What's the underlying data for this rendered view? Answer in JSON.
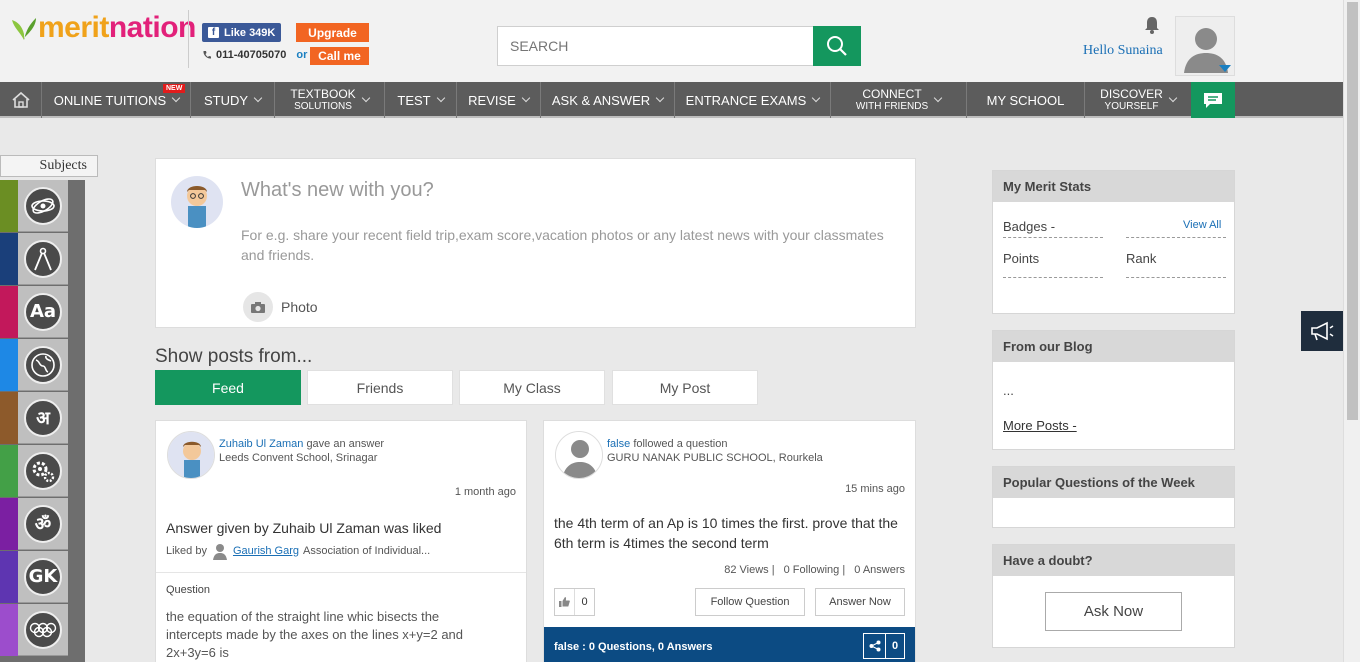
{
  "brand": {
    "merit": "merit",
    "nation": "nation"
  },
  "header": {
    "fb_like": "Like 349K",
    "upgrade": "Upgrade",
    "phone": "011-40705070",
    "or": "or",
    "call_me": "Call me",
    "search_placeholder": "SEARCH",
    "hello": "Hello Sunaina"
  },
  "nav": {
    "items": [
      {
        "label": "ONLINE TUITIONS",
        "badge": "NEW"
      },
      {
        "label": "STUDY"
      },
      {
        "label": "TEXTBOOK",
        "label2": "SOLUTIONS"
      },
      {
        "label": "TEST"
      },
      {
        "label": "REVISE"
      },
      {
        "label": "ASK & ANSWER"
      },
      {
        "label": "ENTRANCE EXAMS"
      },
      {
        "label": "CONNECT",
        "label2": "WITH FRIENDS"
      },
      {
        "label": "MY SCHOOL"
      },
      {
        "label": "DISCOVER",
        "label2": "YOURSELF"
      }
    ]
  },
  "subjects": {
    "tab": "Subjects",
    "colors": [
      "#6b8e23",
      "#1a3f7a",
      "#c2185b",
      "#1e88e5",
      "#8d5a2b",
      "#43a047",
      "#7b1fa2",
      "#5e35b1",
      "#9c4dcc"
    ],
    "icons": [
      "atom-icon",
      "compass-icon",
      "Aa",
      "globe-icon",
      "अ",
      "gears-icon",
      "ॐ",
      "GK",
      "olympic-rings-icon"
    ]
  },
  "compose": {
    "prompt": "What's new with you?",
    "hint": "For e.g. share your recent field trip,exam score,vacation photos or any latest news with your classmates and friends.",
    "photo": "Photo"
  },
  "feed": {
    "heading": "Show posts from...",
    "tabs": [
      "Feed",
      "Friends",
      "My Class",
      "My Post"
    ],
    "active_tab": "Feed"
  },
  "post1": {
    "user": "Zuhaib Ul Zaman",
    "action": "gave an answer",
    "school": "Leeds Convent School, Srinagar",
    "time": "1 month ago",
    "title": "Answer given by Zuhaib Ul Zaman was liked",
    "liked_by": "Liked by",
    "liker": "Gaurish Garg",
    "liker_school": "Association of Individual...",
    "question_label": "Question",
    "question": "the equation of the straight line whic bisects the intercepts made by the axes on the lines x+y=2 and 2x+3y=6 is"
  },
  "post2": {
    "user": "false",
    "action": "followed a question",
    "school": "GURU NANAK PUBLIC SCHOOL, Rourkela",
    "time": "15 mins ago",
    "title": "the 4th term of an Ap is 10 times the first. prove that the 6th term is 4times the second term",
    "views": "82 Views",
    "following": "0 Following",
    "answers": "0 Answers",
    "likes": "0",
    "follow_btn": "Follow Question",
    "answer_btn": "Answer Now",
    "footer": "false : 0 Questions, 0 Answers",
    "shares": "0"
  },
  "sidebar": {
    "merit": {
      "title": "My Merit Stats",
      "badges": "Badges -",
      "view_all": "View All",
      "points": "Points",
      "rank": "Rank"
    },
    "blog": {
      "title": "From our Blog",
      "ellipsis": "...",
      "more": "More Posts -"
    },
    "popular": {
      "title": "Popular Questions of the Week"
    },
    "doubt": {
      "title": "Have a doubt?",
      "ask": "Ask Now"
    }
  }
}
